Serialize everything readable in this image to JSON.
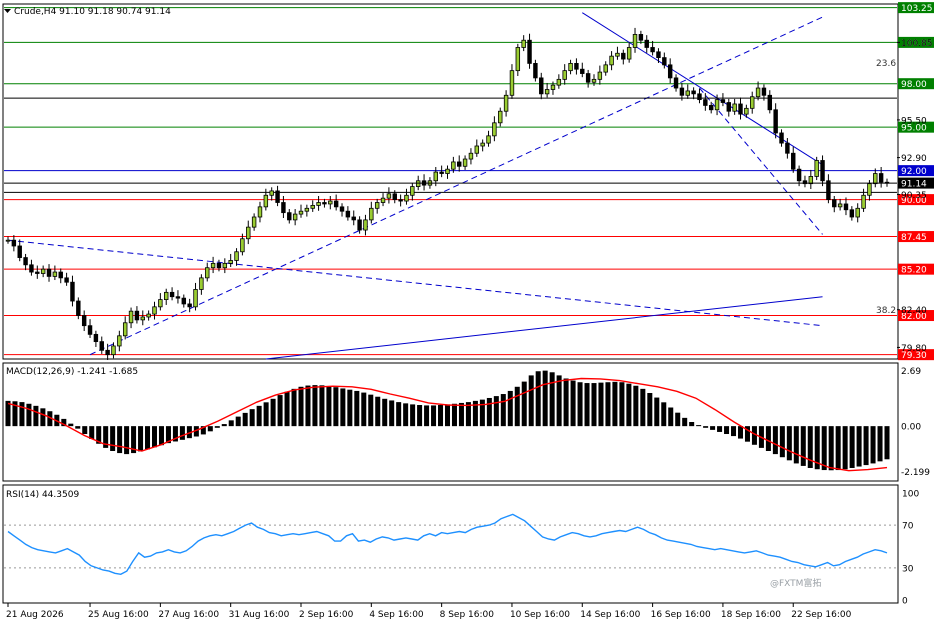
{
  "header": {
    "symbol_line": "Crude,H4  91.10 91.18 90.74 91.14"
  },
  "macd_label": "MACD(12,26,9) -1.241 -1.685",
  "rsi_label": "RSI(14) 44.3509",
  "watermark": "@FXTM富拓",
  "fib_labels": {
    "f236": "23.6",
    "f382": "38.2"
  },
  "colors": {
    "green": "#008000",
    "red": "#ff0000",
    "blue": "#0000cc",
    "black": "#000000",
    "rsi": "#1e90ff",
    "signal": "#ff0000"
  },
  "chart_data": [
    {
      "type": "candlestick",
      "title": "Crude,H4",
      "ylim": [
        79.0,
        103.5
      ],
      "price_axis_ticks": [
        "100.85",
        "95.50",
        "92.90",
        "90.35",
        "82.40",
        "79.80"
      ],
      "current_price": "91.14",
      "horizontal_levels": [
        {
          "value": 103.25,
          "label": "103.25",
          "color": "green"
        },
        {
          "value": 100.85,
          "label": "100.85",
          "color": "green"
        },
        {
          "value": 98.0,
          "label": "98.00",
          "color": "green"
        },
        {
          "value": 95.0,
          "label": "95.00",
          "color": "green"
        },
        {
          "value": 92.0,
          "label": "92.00",
          "color": "blue"
        },
        {
          "value": 90.0,
          "label": "90.00",
          "color": "red"
        },
        {
          "value": 87.45,
          "label": "87.45",
          "color": "red"
        },
        {
          "value": 85.2,
          "label": "85.20",
          "color": "red"
        },
        {
          "value": 82.0,
          "label": "82.00",
          "color": "red"
        },
        {
          "value": 79.3,
          "label": "79.30",
          "color": "red"
        }
      ],
      "x_labels": [
        "21 Aug 2026",
        "25 Aug 16:00",
        "27 Aug 16:00",
        "31 Aug 16:00",
        "2 Sep 16:00",
        "4 Sep 16:00",
        "8 Sep 16:00",
        "10 Sep 16:00",
        "14 Sep 16:00",
        "16 Sep 16:00",
        "18 Sep 16:00",
        "22 Sep 16:00"
      ],
      "closes": [
        87.2,
        86.8,
        86.0,
        85.5,
        85.0,
        84.9,
        85.2,
        84.7,
        85.0,
        84.6,
        84.3,
        83.0,
        82.0,
        81.3,
        80.7,
        80.2,
        79.6,
        79.3,
        79.9,
        80.6,
        81.5,
        82.3,
        81.7,
        81.9,
        82.1,
        82.6,
        83.1,
        83.6,
        83.3,
        83.2,
        82.8,
        82.6,
        83.8,
        84.6,
        85.3,
        85.6,
        85.3,
        85.6,
        85.8,
        86.4,
        87.3,
        88.1,
        88.8,
        89.5,
        90.3,
        90.6,
        89.8,
        89.1,
        88.6,
        89.0,
        89.2,
        89.4,
        89.6,
        89.8,
        89.7,
        89.9,
        89.5,
        89.2,
        88.8,
        88.6,
        87.9,
        88.6,
        89.4,
        89.8,
        90.1,
        90.4,
        90.0,
        89.9,
        90.3,
        90.9,
        91.3,
        91.0,
        91.3,
        91.9,
        91.8,
        92.1,
        92.6,
        92.3,
        92.8,
        93.2,
        93.7,
        93.9,
        94.4,
        95.3,
        96.1,
        97.2,
        98.9,
        100.5,
        101.0,
        99.4,
        98.4,
        97.3,
        97.6,
        97.9,
        98.3,
        98.9,
        99.4,
        99.0,
        98.7,
        98.1,
        98.3,
        98.8,
        99.3,
        99.9,
        100.1,
        99.7,
        100.5,
        101.4,
        101.0,
        100.5,
        100.2,
        99.8,
        99.3,
        98.4,
        97.7,
        97.2,
        97.5,
        97.3,
        96.9,
        96.5,
        96.2,
        96.9,
        96.7,
        96.1,
        96.6,
        95.9,
        96.3,
        97.1,
        97.7,
        97.2,
        96.2,
        94.6,
        93.9,
        93.2,
        92.1,
        91.3,
        91.1,
        91.6,
        92.7,
        91.3,
        90.0,
        89.5,
        89.7,
        89.3,
        88.8,
        89.4,
        90.3,
        91.1,
        91.8,
        91.2,
        91.14
      ],
      "overlays": [
        {
          "type": "dashed-line",
          "from": {
            "date": "25 Aug 16:00",
            "value": 79.3
          },
          "to": {
            "date": "22 Sep 20:00",
            "value": 102.6
          }
        },
        {
          "type": "dashed-line",
          "from": {
            "date": "21 Aug 2026",
            "value": 87.2
          },
          "to": {
            "date": "22 Sep 20:00",
            "value": 81.3
          }
        },
        {
          "type": "solid-line",
          "from": {
            "date": "2 Sep 00:00",
            "value": 79.0
          },
          "to": {
            "date": "22 Sep 20:00",
            "value": 83.3
          }
        },
        {
          "type": "solid-line",
          "from": {
            "date": "14 Sep 16:00",
            "value": 102.9
          },
          "to": {
            "date": "22 Sep 20:00",
            "value": 92.4
          }
        },
        {
          "type": "dashed-line",
          "from": {
            "date": "18 Sep 00:00",
            "value": 97.7
          },
          "to": {
            "date": "22 Sep 20:00",
            "value": 87.6
          }
        },
        {
          "type": "fib-level",
          "value": 97.0,
          "label": "23.6"
        },
        {
          "type": "fib-level",
          "value": 90.5,
          "label": "38.2"
        }
      ]
    },
    {
      "type": "histogram",
      "title": "MACD(12,26,9)",
      "ylim": [
        -2.6,
        3.0
      ],
      "axis_ticks": [
        "2.69",
        "0.00",
        "-2.199"
      ],
      "values": [
        1.22,
        1.2,
        1.16,
        1.08,
        0.98,
        0.86,
        0.72,
        0.55,
        0.35,
        0.12,
        -0.12,
        -0.38,
        -0.62,
        -0.85,
        -1.05,
        -1.2,
        -1.3,
        -1.35,
        -1.3,
        -1.22,
        -1.12,
        -1.02,
        -0.92,
        -0.82,
        -0.74,
        -0.66,
        -0.58,
        -0.5,
        -0.4,
        -0.25,
        -0.08,
        0.1,
        0.28,
        0.46,
        0.64,
        0.82,
        0.98,
        1.15,
        1.32,
        1.5,
        1.66,
        1.8,
        1.9,
        1.96,
        1.98,
        1.97,
        1.93,
        1.88,
        1.82,
        1.76,
        1.7,
        1.62,
        1.52,
        1.42,
        1.32,
        1.24,
        1.16,
        1.1,
        1.05,
        1.02,
        1.0,
        1.0,
        1.02,
        1.05,
        1.08,
        1.12,
        1.16,
        1.22,
        1.28,
        1.36,
        1.45,
        1.55,
        1.7,
        1.9,
        2.15,
        2.45,
        2.65,
        2.68,
        2.6,
        2.45,
        2.3,
        2.2,
        2.12,
        2.08,
        2.08,
        2.1,
        2.12,
        2.14,
        2.12,
        2.05,
        1.95,
        1.8,
        1.6,
        1.38,
        1.15,
        0.9,
        0.65,
        0.4,
        0.2,
        0.05,
        -0.08,
        -0.18,
        -0.28,
        -0.38,
        -0.48,
        -0.6,
        -0.75,
        -0.9,
        -1.05,
        -1.2,
        -1.35,
        -1.5,
        -1.65,
        -1.8,
        -1.92,
        -2.02,
        -2.08,
        -2.12,
        -2.13,
        -2.12,
        -2.08,
        -2.02,
        -1.95,
        -1.88,
        -1.8,
        -1.7,
        -1.6
      ],
      "signal": [
        1.1,
        0.85,
        0.5,
        0.05,
        -0.45,
        -0.85,
        -1.0,
        -1.2,
        -0.9,
        -0.5,
        -0.15,
        0.25,
        0.7,
        1.15,
        1.5,
        1.75,
        1.88,
        1.93,
        1.9,
        1.78,
        1.55,
        1.35,
        1.12,
        1.02,
        1.0,
        1.05,
        1.2,
        1.6,
        2.0,
        2.2,
        2.3,
        2.28,
        2.2,
        2.05,
        1.9,
        1.68,
        1.35,
        0.8,
        0.2,
        -0.35,
        -0.8,
        -1.25,
        -1.65,
        -2.0,
        -2.15,
        -2.1,
        -2.0
      ]
    },
    {
      "type": "line",
      "title": "RSI(14)",
      "ylim": [
        0,
        100
      ],
      "axis_ticks": [
        "100",
        "70",
        "30",
        "0"
      ],
      "values": [
        64,
        60,
        56,
        52,
        49,
        47,
        46,
        45,
        44,
        46,
        48,
        45,
        42,
        36,
        32,
        30,
        28,
        27,
        25,
        24,
        27,
        36,
        44,
        40,
        41,
        44,
        45,
        47,
        45,
        44,
        46,
        50,
        55,
        58,
        60,
        61,
        60,
        62,
        64,
        67,
        70,
        72,
        68,
        66,
        63,
        62,
        60,
        61,
        62,
        61,
        62,
        63,
        64,
        62,
        60,
        55,
        55,
        60,
        62,
        55,
        56,
        54,
        57,
        59,
        58,
        56,
        57,
        58,
        57,
        56,
        60,
        62,
        60,
        63,
        62,
        63,
        64,
        63,
        66,
        68,
        69,
        70,
        72,
        76,
        78,
        80,
        77,
        74,
        69,
        64,
        59,
        57,
        56,
        59,
        61,
        63,
        62,
        60,
        59,
        60,
        62,
        63,
        64,
        65,
        64,
        66,
        68,
        66,
        63,
        61,
        58,
        56,
        55,
        54,
        53,
        52,
        50,
        49,
        48,
        47,
        48,
        47,
        46,
        45,
        44,
        45,
        46,
        44,
        42,
        41,
        40,
        38,
        36,
        35,
        33,
        32,
        31,
        33,
        35,
        32,
        33,
        36,
        38,
        40,
        43,
        45,
        47,
        46,
        44
      ]
    }
  ]
}
